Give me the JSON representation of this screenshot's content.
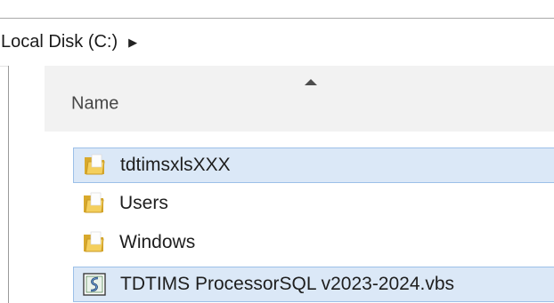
{
  "address_bar": {
    "crumb": "Local Disk (C:)",
    "arrow": "▶"
  },
  "column_header": {
    "name": "Name",
    "sort": "ascending"
  },
  "files": [
    {
      "name": "tdtimsxlsXXX",
      "type": "folder",
      "icon": "folder-icon",
      "selected": true
    },
    {
      "name": "Users",
      "type": "folder",
      "icon": "folder-icon",
      "selected": false
    },
    {
      "name": "Windows",
      "type": "folder",
      "icon": "folder-icon",
      "selected": false
    },
    {
      "name": "TDTIMS ProcessorSQL v2023-2024.vbs",
      "type": "vbs-script",
      "icon": "vbs-script-icon",
      "selected": true
    }
  ],
  "colors": {
    "selection_fill": "#dbe8f7",
    "selection_border": "#9cc0e8",
    "folder_yellow": "#e8c34a"
  }
}
